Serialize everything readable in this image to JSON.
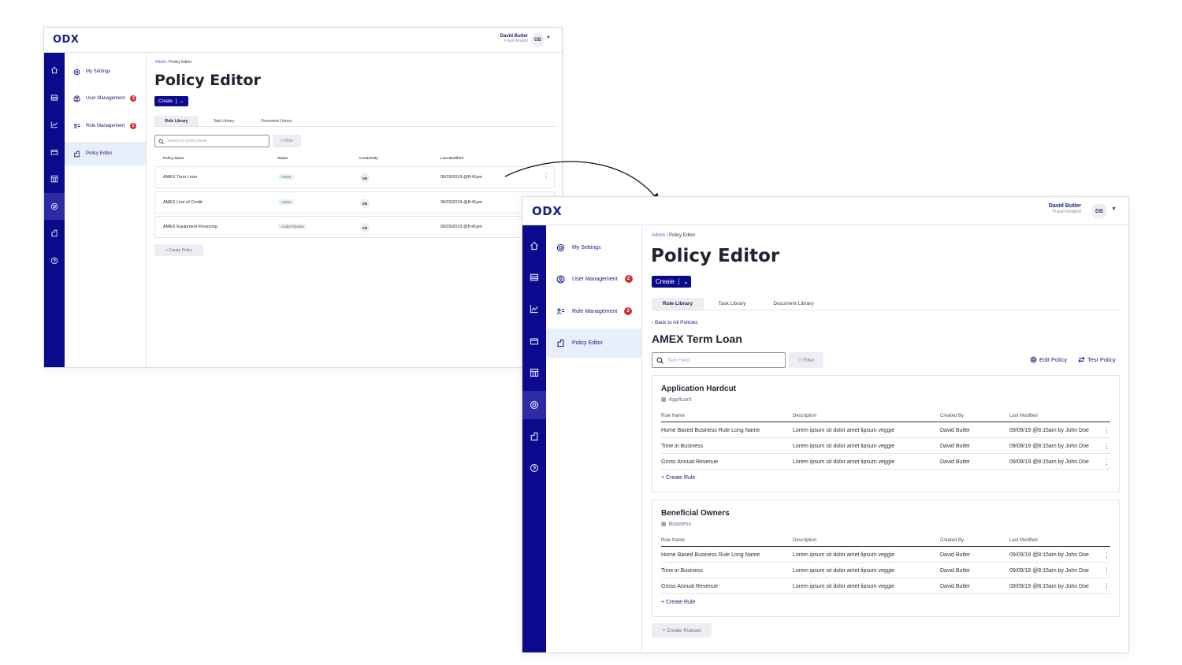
{
  "colors": {
    "brand_navy": "#0c0a8c",
    "accent_blue": "#3f62d6",
    "badge_red": "#d32f2f",
    "active_green": "#2e7d32"
  },
  "app": {
    "logo": "ODX",
    "user_name": "David Butler",
    "user_role": "Fraud Analyst",
    "user_initials": "DB"
  },
  "rail_icons": [
    "home-icon",
    "dashboard-icon",
    "chart-icon",
    "card-icon",
    "table-icon",
    "gear-icon",
    "building-icon",
    "help-icon"
  ],
  "sidebar": {
    "items": [
      {
        "label": "My Settings",
        "icon": "gear-icon",
        "badge": ""
      },
      {
        "label": "User Management",
        "icon": "user-icon",
        "badge": "2"
      },
      {
        "label": "Role Management",
        "icon": "role-icon",
        "badge": "2"
      },
      {
        "label": "Policy Editor",
        "icon": "building-icon",
        "badge": ""
      }
    ]
  },
  "page": {
    "breadcrumb_root": "Admin",
    "breadcrumb_sep": "/",
    "breadcrumb_current": "Policy Editor",
    "title": "Policy Editor",
    "create_label": "Create",
    "tabs": [
      "Rule Library",
      "Task Library",
      "Document Library"
    ]
  },
  "list_view": {
    "search_placeholder": "Search by policy name",
    "filter_label": "Filter",
    "columns": [
      "Policy Name",
      "Status",
      "Created By",
      "Last Modified"
    ],
    "rows": [
      {
        "name": "AMEX Term Loan",
        "status": "Active",
        "created_by": "DB",
        "modified": "09/29/2019 @8:41pm"
      },
      {
        "name": "AMEX Line of Credit",
        "status": "Active",
        "created_by": "DB",
        "modified": "09/29/2019 @8:41pm"
      },
      {
        "name": "AMEX Equipment Financing",
        "status": "Under Review",
        "created_by": "DB",
        "modified": "09/29/2019 @8:41pm"
      }
    ],
    "create_policy_label": "+ Create Policy"
  },
  "detail_view": {
    "back_label": "Back to All Policies",
    "policy_title": "AMEX Term Loan",
    "search_placeholder": "Text Field",
    "filter_label": "Filter",
    "edit_label": "Edit Policy",
    "test_label": "Test Policy",
    "columns": [
      "Rule Name",
      "Description",
      "Created By",
      "Last Modified"
    ],
    "rulesets": [
      {
        "title": "Application Hardcut",
        "subtitle": "Applicant",
        "rows": [
          {
            "name": "Home Based Business Rule Long Name",
            "desc": "Lorem ipsum sit dolor amet lipsum veggie",
            "by": "David Butler",
            "mod": "09/09/19 @8:15am by John Doe"
          },
          {
            "name": "Time in Business",
            "desc": "Lorem ipsum sit dolor amet lipsum veggie",
            "by": "David Butler",
            "mod": "09/09/19 @8:15am by John Doe"
          },
          {
            "name": "Gross Annual Revenue",
            "desc": "Lorem ipsum sit dolor amet lipsum veggie",
            "by": "David Butler",
            "mod": "09/09/19 @8:15am by John Doe"
          }
        ],
        "create_rule": "+ Create Rule"
      },
      {
        "title": "Beneficial Owners",
        "subtitle": "Business",
        "rows": [
          {
            "name": "Home Based Business Rule Long Name",
            "desc": "Lorem ipsum sit dolor amet lipsum veggie",
            "by": "David Butler",
            "mod": "09/09/19 @8:15am by John Doe"
          },
          {
            "name": "Time in Business",
            "desc": "Lorem ipsum sit dolor amet lipsum veggie",
            "by": "David Butler",
            "mod": "09/09/19 @8:15am by John Doe"
          },
          {
            "name": "Gross Annual Revenue",
            "desc": "Lorem ipsum sit dolor amet lipsum veggie",
            "by": "David Butler",
            "mod": "09/09/19 @8:15am by John Doe"
          }
        ],
        "create_rule": "+ Create Rule"
      }
    ],
    "create_ruleset_label": "+ Create Ruleset"
  }
}
